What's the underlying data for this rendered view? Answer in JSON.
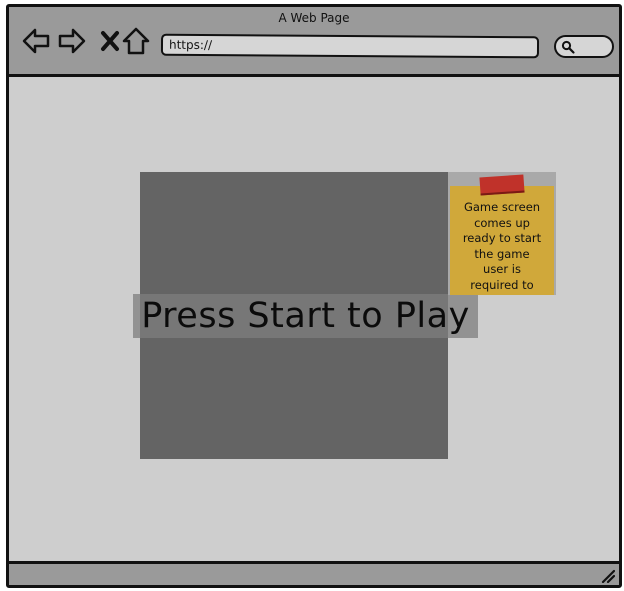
{
  "window": {
    "title": "A Web Page"
  },
  "toolbar": {
    "back_icon": "back-arrow-icon",
    "forward_icon": "forward-arrow-icon",
    "stop_icon": "close-icon",
    "home_icon": "home-icon",
    "address_value": "https://",
    "search_icon": "search-icon"
  },
  "game": {
    "start_prompt": "Press Start to Play"
  },
  "note": {
    "text": "Game screen\ncomes up\nready to start\nthe game\nuser is\nrequired to",
    "paper_color": "#d0a83a",
    "tape_color": "#c0322a"
  },
  "colors": {
    "frame_bg": "#cecece",
    "toolbar_bg": "#9a9a9a",
    "game_screen_bg": "#646464"
  }
}
